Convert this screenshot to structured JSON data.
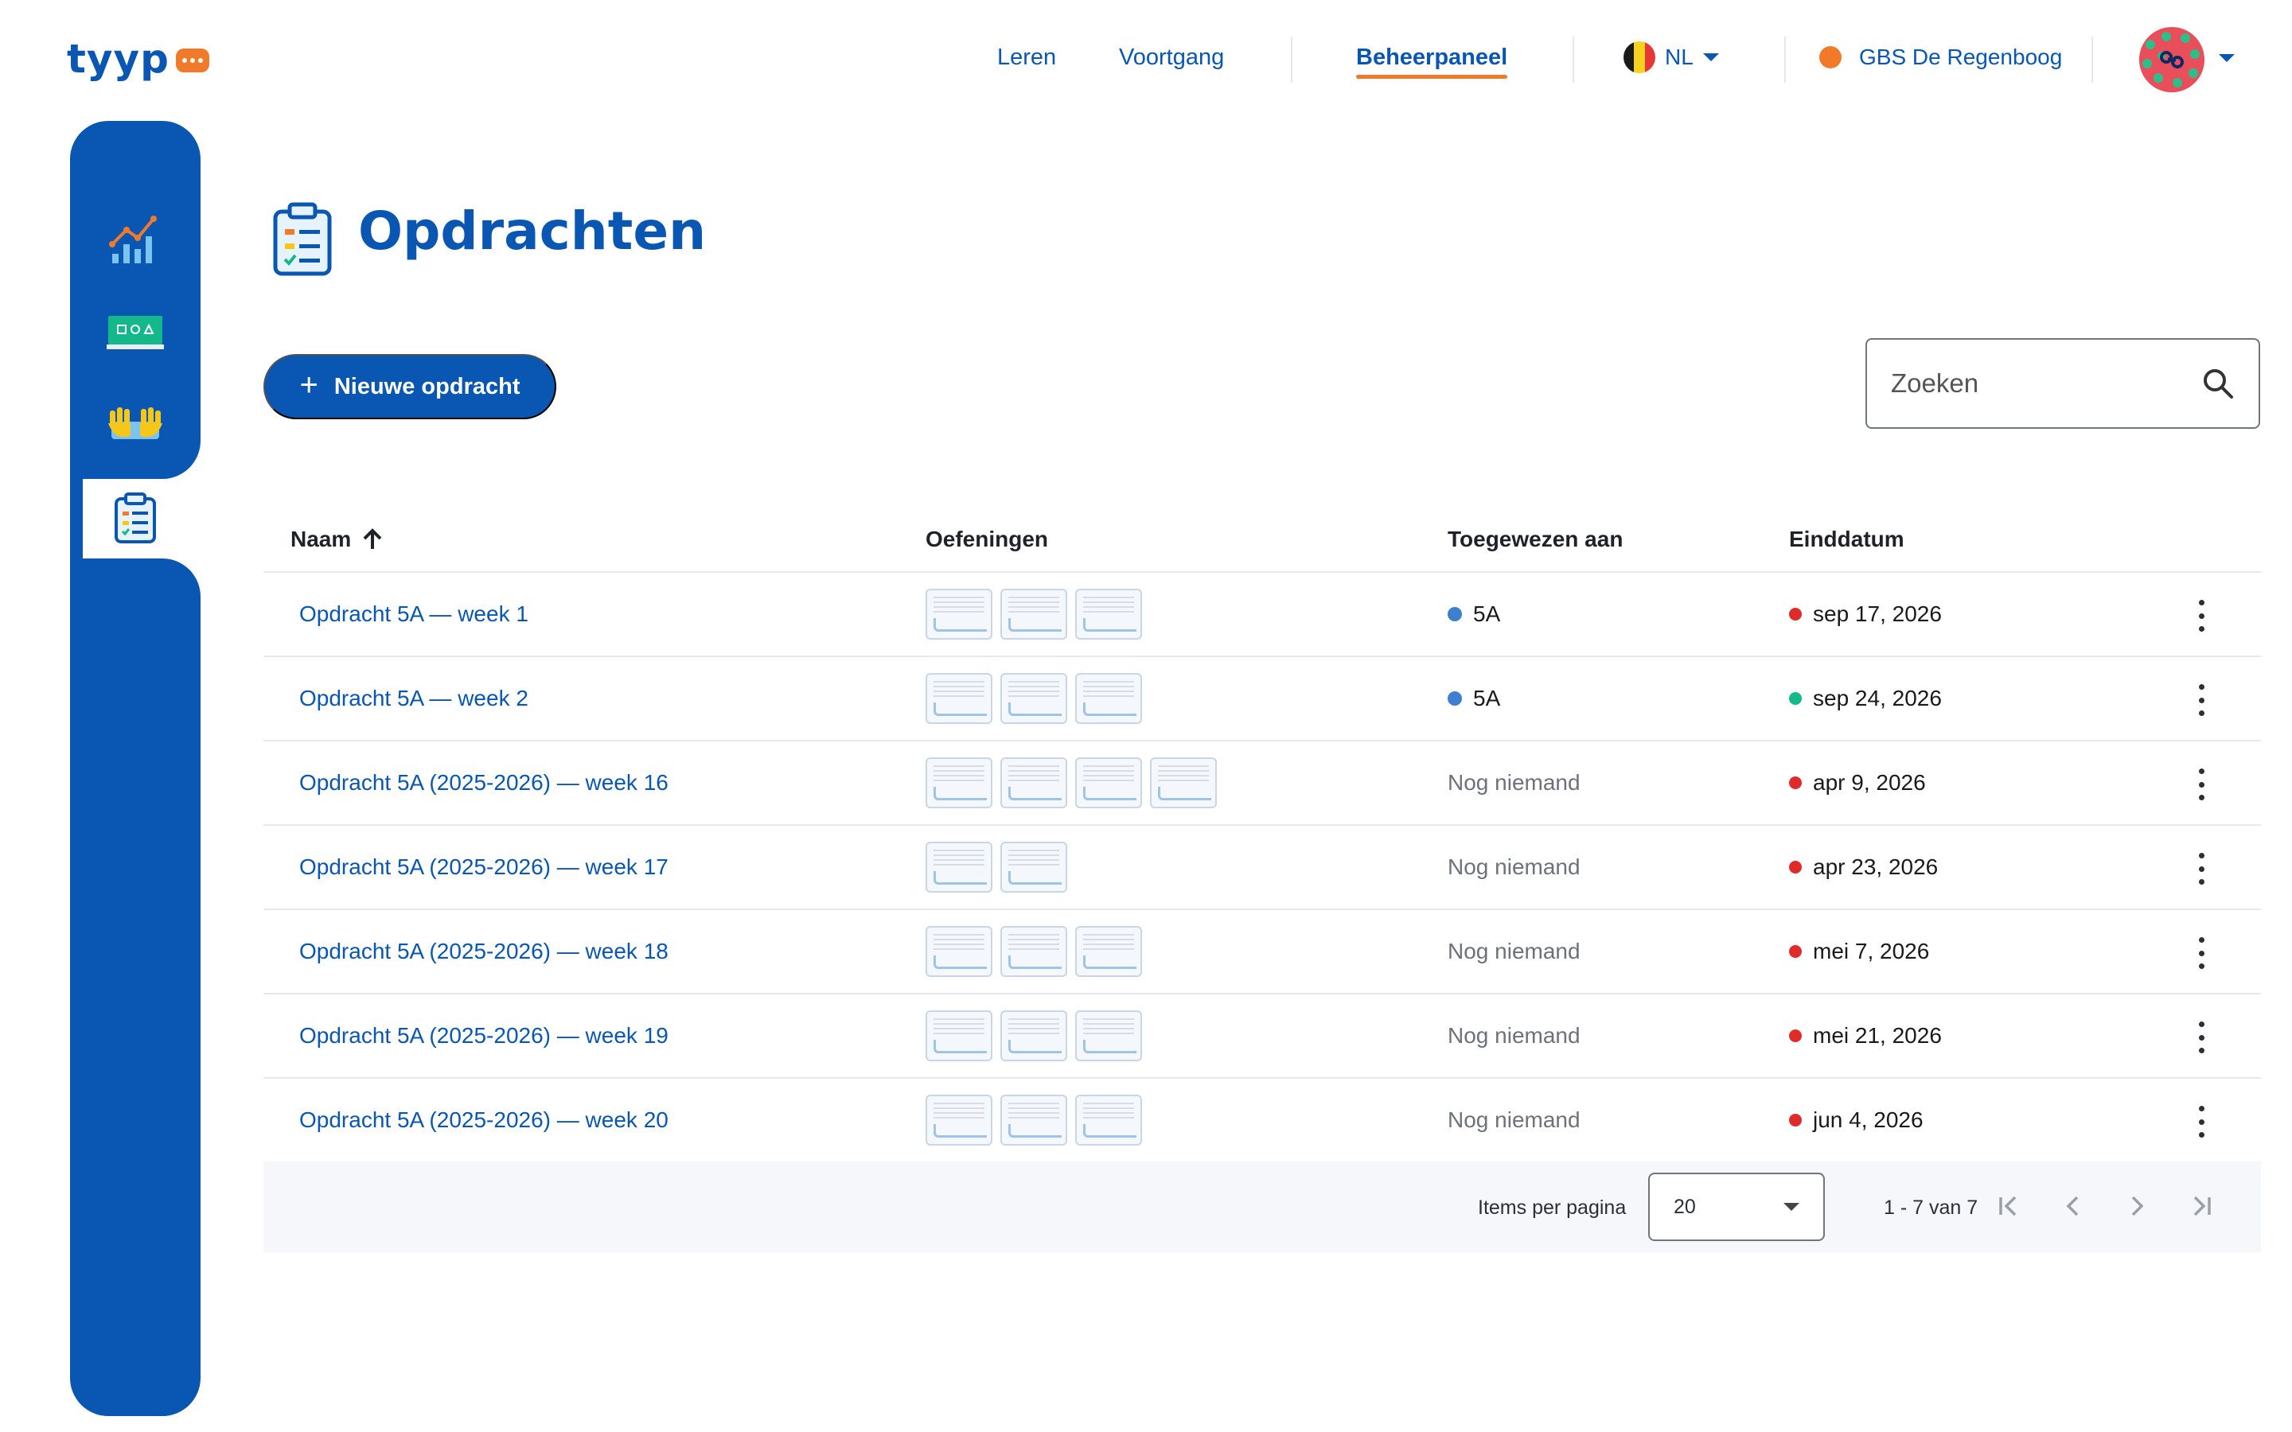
{
  "app": {
    "logo_text": "tyyp"
  },
  "topnav": {
    "links": [
      "Leren",
      "Voortgang",
      "Beheerpaneel"
    ],
    "active": "Beheerpaneel",
    "language": "NL",
    "school": "GBS De Regenboog"
  },
  "colors": {
    "brand_blue": "#0a56b3",
    "accent_orange": "#f07a2a",
    "status_red": "#e02b2b",
    "status_green": "#14b88a",
    "class_blue": "#3f7fd0"
  },
  "sidebar": {
    "items": [
      {
        "name": "statistics",
        "icon": "chart-icon"
      },
      {
        "name": "classes",
        "icon": "classroom-board-icon"
      },
      {
        "name": "typing",
        "icon": "hands-keyboard-icon"
      },
      {
        "name": "assignments",
        "icon": "clipboard-icon",
        "active": true
      }
    ]
  },
  "page": {
    "title": "Opdrachten",
    "new_button": "Nieuwe opdracht",
    "search_placeholder": "Zoeken"
  },
  "table": {
    "columns": [
      "Naam",
      "Oefeningen",
      "Toegewezen aan",
      "Einddatum"
    ],
    "sort_column": "Naam",
    "rows": [
      {
        "name": "Opdracht 5A — week 1",
        "exercises": 3,
        "assigned": "5A",
        "assigned_none": false,
        "due": "sep 17, 2026",
        "due_status": "red"
      },
      {
        "name": "Opdracht 5A — week 2",
        "exercises": 3,
        "assigned": "5A",
        "assigned_none": false,
        "due": "sep 24, 2026",
        "due_status": "green"
      },
      {
        "name": "Opdracht 5A (2025-2026) — week 16",
        "exercises": 4,
        "assigned": "Nog niemand",
        "assigned_none": true,
        "due": "apr 9, 2026",
        "due_status": "red"
      },
      {
        "name": "Opdracht 5A (2025-2026) — week 17",
        "exercises": 2,
        "assigned": "Nog niemand",
        "assigned_none": true,
        "due": "apr 23, 2026",
        "due_status": "red"
      },
      {
        "name": "Opdracht 5A (2025-2026) — week 18",
        "exercises": 3,
        "assigned": "Nog niemand",
        "assigned_none": true,
        "due": "mei 7, 2026",
        "due_status": "red"
      },
      {
        "name": "Opdracht 5A (2025-2026) — week 19",
        "exercises": 3,
        "assigned": "Nog niemand",
        "assigned_none": true,
        "due": "mei 21, 2026",
        "due_status": "red"
      },
      {
        "name": "Opdracht 5A (2025-2026) — week 20",
        "exercises": 3,
        "assigned": "Nog niemand",
        "assigned_none": true,
        "due": "jun 4, 2026",
        "due_status": "red"
      }
    ]
  },
  "paginator": {
    "items_label": "Items per pagina",
    "page_size": "20",
    "range": "1 - 7 van 7"
  }
}
